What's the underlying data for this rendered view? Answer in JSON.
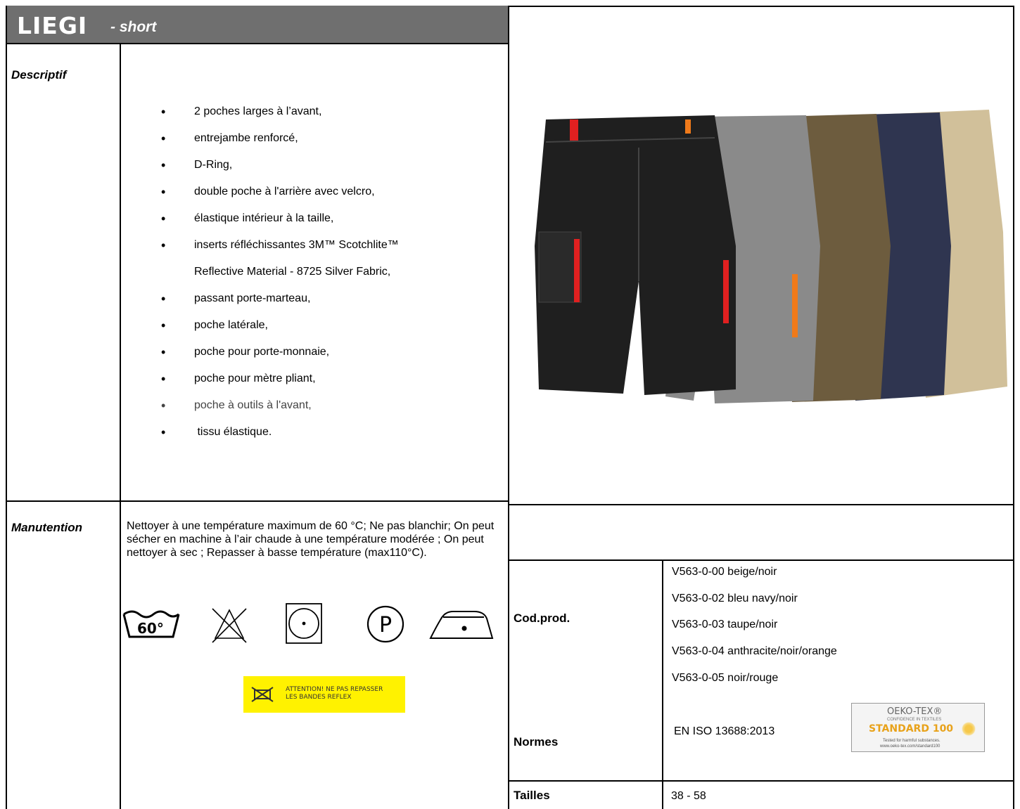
{
  "header": {
    "product_name": "LIEGI",
    "product_type": "- short"
  },
  "descriptif": {
    "label": "Descriptif",
    "features": [
      "2 poches larges à l’avant,",
      "entrejambe renforcé,",
      "D-Ring,",
      "double poche à l'arrière avec velcro,",
      "élastique intérieur à la taille,",
      "inserts réfléchissantes 3M™ Scotchlite™",
      "Reflective Material - 8725 Silver Fabric,",
      "passant porte-marteau,",
      "poche latérale,",
      "poche pour porte-monnaie,",
      "poche pour mètre pliant,",
      "poche à outils à l'avant,",
      " tissu élastique."
    ]
  },
  "manutention": {
    "label": "Manutention",
    "text": "Nettoyer à une température maximum de 60 °C; Ne pas blanchir; On peut sécher en machine à l’air chaude à une température  modérée ; On peut nettoyer à sec ; Repasser à basse température  (max110°C).",
    "wash_temp": "60°",
    "dryclean_letter": "P",
    "icons": [
      "wash-60-icon",
      "no-bleach-icon",
      "tumble-dry-icon",
      "dry-clean-p-icon",
      "iron-low-icon"
    ],
    "warning_line1": "ATTENTION! NE PAS REPASSER",
    "warning_line2": "LES BANDES REFLEX",
    "warning_color": "#fff200"
  },
  "codes": {
    "label": "Cod.prod.",
    "items": [
      "V563-0-00 beige/noir",
      "V563-0-02 bleu navy/noir",
      "V563-0-03 taupe/noir",
      "V563-0-04 anthracite/noir/orange",
      "V563-0-05 noir/rouge"
    ]
  },
  "normes": {
    "label": "Normes",
    "value": "EN ISO 13688:2013",
    "oeko_title": "OEKO-TEX®",
    "oeko_tagline": "CONFIDENCE IN TEXTILES",
    "oeko_standard": "STANDARD 100",
    "oeko_note1": "Tested for harmful substances.",
    "oeko_note2": "www.oeko-tex.com/standard100"
  },
  "tailles": {
    "label": "Tailles",
    "value": "38 - 58"
  },
  "photo": {
    "image": "work-shorts-five-colors",
    "colors": [
      "#d1c09a",
      "#2f3550",
      "#6d5c3e",
      "#8a8a8a",
      "#1f1f1f"
    ],
    "accent_colors": [
      "#e02020",
      "#f07a1a"
    ]
  }
}
